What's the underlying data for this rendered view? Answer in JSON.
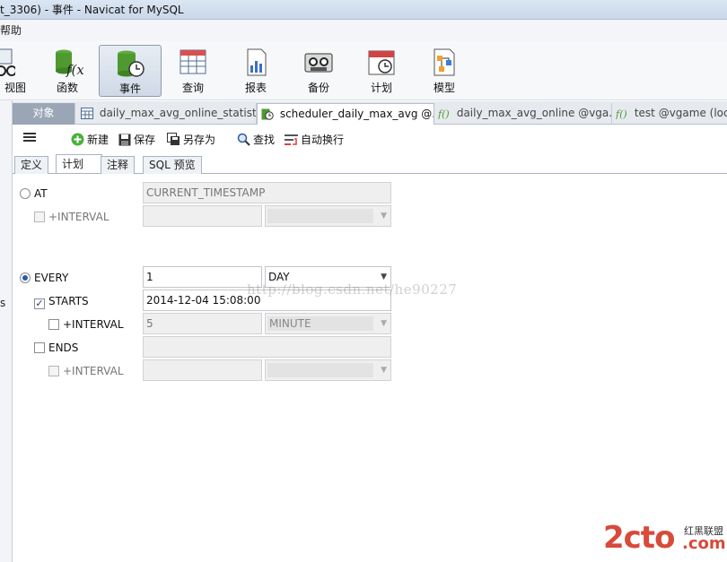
{
  "window": {
    "title": "t_3306) - 事件 - Navicat for MySQL"
  },
  "menu": {
    "help": "帮助"
  },
  "main_toolbar": [
    {
      "label": "视图",
      "icon": "view-icon"
    },
    {
      "label": "函数",
      "icon": "function-icon"
    },
    {
      "label": "事件",
      "icon": "event-icon"
    },
    {
      "label": "查询",
      "icon": "query-icon"
    },
    {
      "label": "报表",
      "icon": "report-icon"
    },
    {
      "label": "备份",
      "icon": "backup-icon"
    },
    {
      "label": "计划",
      "icon": "schedule-icon"
    },
    {
      "label": "模型",
      "icon": "model-icon"
    }
  ],
  "tabs": [
    {
      "label": "对象"
    },
    {
      "label": "daily_max_avg_online_statist..."
    },
    {
      "label": "scheduler_daily_max_avg @..."
    },
    {
      "label": "daily_max_avg_online @vga..."
    },
    {
      "label": "test @vgame (loc"
    }
  ],
  "editor_toolbar": {
    "new": "新建",
    "save": "保存",
    "save_as": "另存为",
    "find": "查找",
    "word_wrap": "自动换行"
  },
  "subtabs": [
    "定义",
    "计划",
    "注释",
    "SQL 预览"
  ],
  "schedule": {
    "at": {
      "label": "AT",
      "value": "CURRENT_TIMESTAMP",
      "interval_label": "+INTERVAL"
    },
    "every": {
      "label": "EVERY",
      "value": "1",
      "unit": "DAY"
    },
    "starts": {
      "label": "STARTS",
      "value": "2014-12-04 15:08:00",
      "interval_label": "+INTERVAL",
      "interval_value": "5",
      "interval_unit": "MINUTE"
    },
    "ends": {
      "label": "ENDS",
      "interval_label": "+INTERVAL"
    }
  },
  "watermark": "http://blog.csdn.net/he90227",
  "left_edge_char": "s",
  "branding": {
    "logo_main": "2cto",
    "logo_tld": ".com",
    "logo_cn": "红黑联盟"
  }
}
